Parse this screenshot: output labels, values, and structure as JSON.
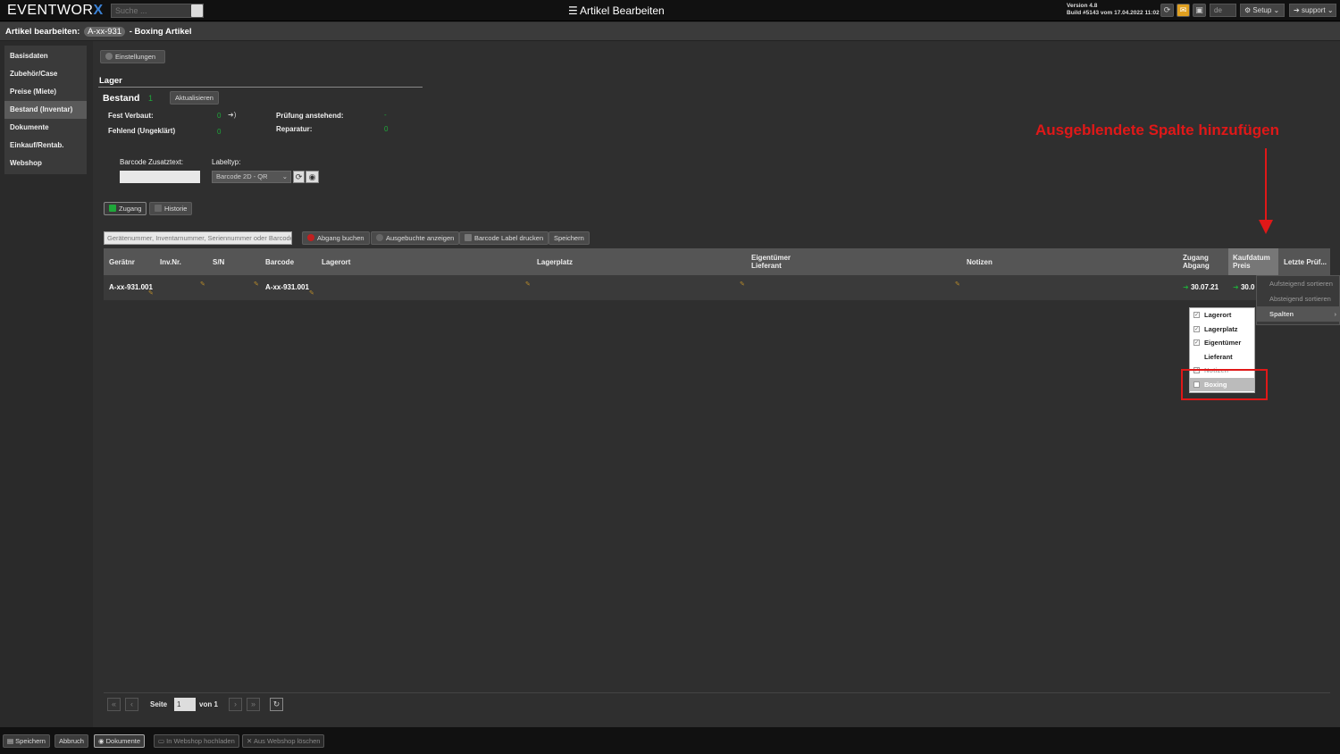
{
  "topbar": {
    "logo_text": "EVENTWOR",
    "logo_x": "X",
    "search_placeholder": "Suche ...",
    "title": "Artikel Bearbeiten",
    "version_line1": "Version 4.8",
    "version_line2": "Build #5143 vom 17.04.2022 11:02",
    "lang": "de",
    "setup_label": "Setup",
    "support_label": "support"
  },
  "subheader": {
    "prefix": "Artikel bearbeiten:",
    "article_id": "A-xx-931",
    "suffix": "- Boxing Artikel"
  },
  "nav": {
    "items": [
      {
        "label": "Basisdaten"
      },
      {
        "label": "Zubehör/Case"
      },
      {
        "label": "Preise (Miete)"
      },
      {
        "label": "Bestand (Inventar)"
      },
      {
        "label": "Dokumente"
      },
      {
        "label": "Einkauf/Rentab."
      },
      {
        "label": "Webshop"
      }
    ]
  },
  "main": {
    "settings_btn": "Einstellungen",
    "lager_title": "Lager",
    "bestand_label": "Bestand",
    "bestand_value": "1",
    "aktualisieren_btn": "Aktualisieren",
    "fest_verbaut_label": "Fest Verbaut:",
    "fest_verbaut_value": "0",
    "fehlend_label": "Fehlend (Ungeklärt)",
    "fehlend_value": "0",
    "pruefung_label": "Prüfung anstehend:",
    "pruefung_value": "-",
    "reparatur_label": "Reparatur:",
    "reparatur_value": "0",
    "barcode_zusatz_label": "Barcode Zusatztext:",
    "labeltyp_label": "Labeltyp:",
    "labeltyp_value": "Barcode 2D - QR",
    "zugang_btn": "Zugang",
    "historie_btn": "Historie",
    "scan_placeholder": "Gerätenummer, Inventarnummer, Seriennummer oder Barcode",
    "abgang_btn": "Abgang buchen",
    "ausgebucht_btn": "Ausgebuchte anzeigen",
    "barcode_label_btn": "Barcode Label drucken",
    "speichern_btn": "Speichern"
  },
  "table": {
    "headers": {
      "geraetnr": "Gerätnr",
      "invnr": "Inv.Nr.",
      "sn": "S/N",
      "barcode": "Barcode",
      "lagerort": "Lagerort",
      "lagerplatz": "Lagerplatz",
      "eigentuemer": "Eigentümer",
      "lieferant": "Lieferant",
      "notizen": "Notizen",
      "zugang": "Zugang",
      "abgang": "Abgang",
      "kaufdatum": "Kaufdatum",
      "preis": "Preis",
      "letzte": "Letzte Prüf..."
    },
    "row": {
      "geraetnr": "A-xx-931.001",
      "barcode": "A-xx-931.001",
      "zugang": "30.07.21",
      "kaufdatum": "30.0"
    }
  },
  "sort_menu": {
    "asc": "Aufsteigend sortieren",
    "desc": "Absteigend sortieren",
    "columns": "Spalten"
  },
  "columns_menu": {
    "items": [
      {
        "label": "Lagerort",
        "checked": "✓"
      },
      {
        "label": "Lagerplatz",
        "checked": "✓"
      },
      {
        "label": "Eigentümer",
        "checked": "✓"
      },
      {
        "label": "Lieferant",
        "checked": ""
      },
      {
        "label": "Notizen",
        "checked": "✓"
      },
      {
        "label": "Boxing",
        "checked": ""
      }
    ]
  },
  "annotation": {
    "text": "Ausgeblendete Spalte hinzufügen",
    "color": "#e01818"
  },
  "pager": {
    "seite_label": "Seite",
    "page_value": "1",
    "von_label": "von 1"
  },
  "footer": {
    "speichern": "Speichern",
    "abbruch": "Abbruch",
    "dokumente": "Dokumente",
    "webshop_upload": "In Webshop hochladen",
    "webshop_delete": "Aus Webshop löschen"
  }
}
